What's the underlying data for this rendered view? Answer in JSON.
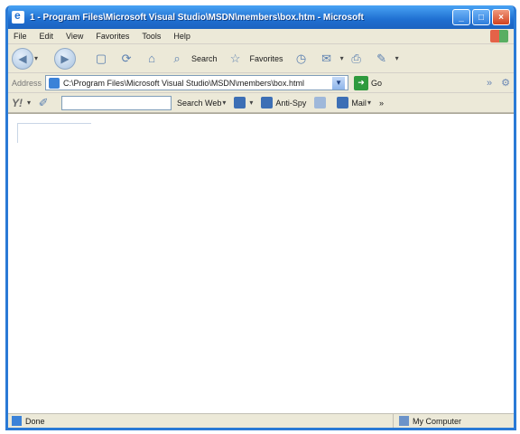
{
  "window": {
    "title": "1 - Program Files\\Microsoft Visual Studio\\MSDN\\members\\box.htm - Microsoft"
  },
  "menu": {
    "items": [
      "File",
      "Edit",
      "View",
      "Favorites",
      "Tools",
      "Help"
    ]
  },
  "toolbar": {
    "search_label": "Search",
    "favorites_label": "Favorites"
  },
  "address": {
    "label": "Address",
    "value": "C:\\Program Files\\Microsoft Visual Studio\\MSDN\\members\\box.html",
    "go_label": "Go"
  },
  "searchbar": {
    "search_web_label": "Search Web",
    "antispy_label": "Anti-Spy",
    "mail_label": "Mail"
  },
  "status": {
    "text": "Done",
    "zone": "My Computer"
  }
}
